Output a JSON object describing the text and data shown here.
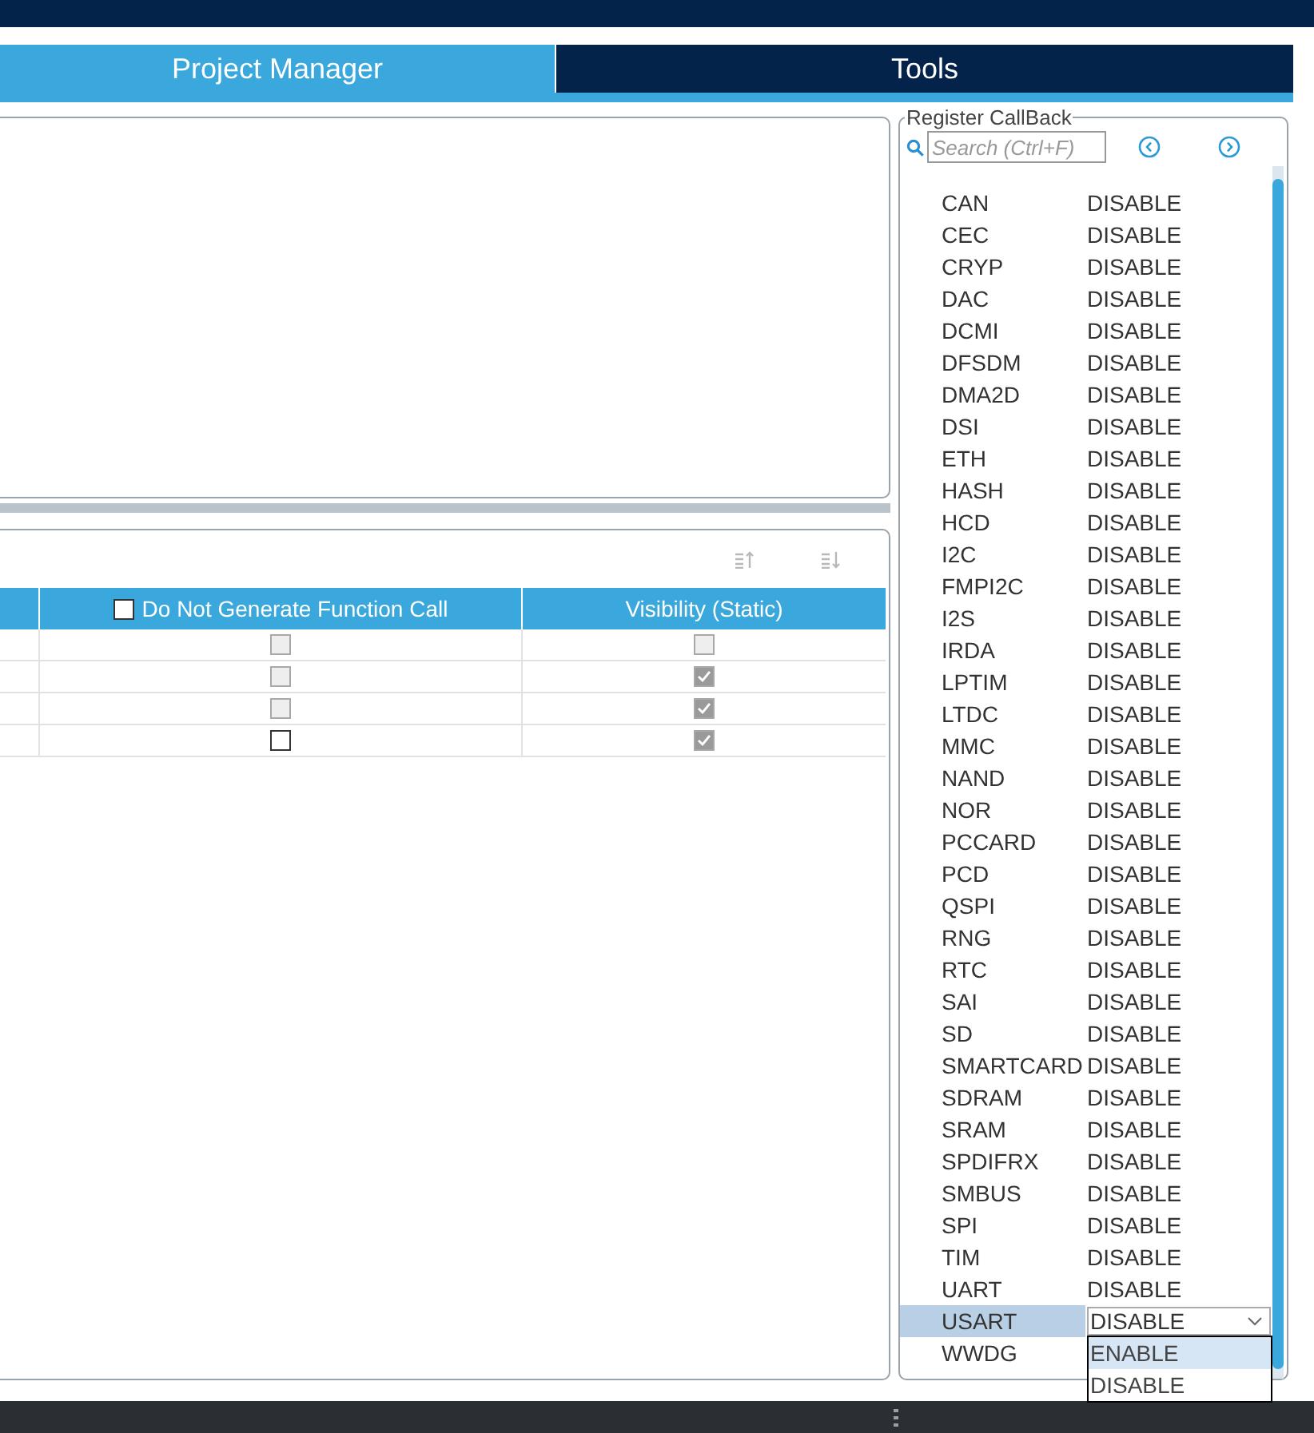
{
  "tabs": [
    {
      "label": "Project Manager",
      "selected": true
    },
    {
      "label": "Tools",
      "selected": false
    }
  ],
  "function_table": {
    "header_checkbox": {
      "checked": false
    },
    "columns": [
      "Do Not Generate Function Call",
      "Visibility (Static)"
    ],
    "rows": [
      {
        "do_not_generate": {
          "checked": false,
          "disabled": true
        },
        "visibility": {
          "checked": false,
          "disabled": true
        }
      },
      {
        "do_not_generate": {
          "checked": false,
          "disabled": true
        },
        "visibility": {
          "checked": true,
          "disabled": true
        }
      },
      {
        "do_not_generate": {
          "checked": false,
          "disabled": true
        },
        "visibility": {
          "checked": true,
          "disabled": true
        }
      },
      {
        "do_not_generate": {
          "checked": false,
          "disabled": false
        },
        "visibility": {
          "checked": true,
          "disabled": true
        }
      }
    ]
  },
  "register_callback": {
    "title": "Register CallBack",
    "search": {
      "placeholder": "Search (Ctrl+F)"
    },
    "items": [
      {
        "name": "CAN",
        "value": "DISABLE",
        "selected": false
      },
      {
        "name": "CEC",
        "value": "DISABLE",
        "selected": false
      },
      {
        "name": "CRYP",
        "value": "DISABLE",
        "selected": false
      },
      {
        "name": "DAC",
        "value": "DISABLE",
        "selected": false
      },
      {
        "name": "DCMI",
        "value": "DISABLE",
        "selected": false
      },
      {
        "name": "DFSDM",
        "value": "DISABLE",
        "selected": false
      },
      {
        "name": "DMA2D",
        "value": "DISABLE",
        "selected": false
      },
      {
        "name": "DSI",
        "value": "DISABLE",
        "selected": false
      },
      {
        "name": "ETH",
        "value": "DISABLE",
        "selected": false
      },
      {
        "name": "HASH",
        "value": "DISABLE",
        "selected": false
      },
      {
        "name": "HCD",
        "value": "DISABLE",
        "selected": false
      },
      {
        "name": "I2C",
        "value": "DISABLE",
        "selected": false
      },
      {
        "name": "FMPI2C",
        "value": "DISABLE",
        "selected": false
      },
      {
        "name": "I2S",
        "value": "DISABLE",
        "selected": false
      },
      {
        "name": "IRDA",
        "value": "DISABLE",
        "selected": false
      },
      {
        "name": "LPTIM",
        "value": "DISABLE",
        "selected": false
      },
      {
        "name": "LTDC",
        "value": "DISABLE",
        "selected": false
      },
      {
        "name": "MMC",
        "value": "DISABLE",
        "selected": false
      },
      {
        "name": "NAND",
        "value": "DISABLE",
        "selected": false
      },
      {
        "name": "NOR",
        "value": "DISABLE",
        "selected": false
      },
      {
        "name": "PCCARD",
        "value": "DISABLE",
        "selected": false
      },
      {
        "name": "PCD",
        "value": "DISABLE",
        "selected": false
      },
      {
        "name": "QSPI",
        "value": "DISABLE",
        "selected": false
      },
      {
        "name": "RNG",
        "value": "DISABLE",
        "selected": false
      },
      {
        "name": "RTC",
        "value": "DISABLE",
        "selected": false
      },
      {
        "name": "SAI",
        "value": "DISABLE",
        "selected": false
      },
      {
        "name": "SD",
        "value": "DISABLE",
        "selected": false
      },
      {
        "name": "SMARTCARD",
        "value": "DISABLE",
        "selected": false
      },
      {
        "name": "SDRAM",
        "value": "DISABLE",
        "selected": false
      },
      {
        "name": "SRAM",
        "value": "DISABLE",
        "selected": false
      },
      {
        "name": "SPDIFRX",
        "value": "DISABLE",
        "selected": false
      },
      {
        "name": "SMBUS",
        "value": "DISABLE",
        "selected": false
      },
      {
        "name": "SPI",
        "value": "DISABLE",
        "selected": false
      },
      {
        "name": "TIM",
        "value": "DISABLE",
        "selected": false
      },
      {
        "name": "UART",
        "value": "DISABLE",
        "selected": false
      },
      {
        "name": "USART",
        "value": "DISABLE",
        "selected": true
      },
      {
        "name": "WWDG",
        "selected": false
      }
    ],
    "dropdown": {
      "options": [
        {
          "label": "ENABLE",
          "selected": true
        },
        {
          "label": "DISABLE",
          "selected": false
        }
      ]
    }
  }
}
